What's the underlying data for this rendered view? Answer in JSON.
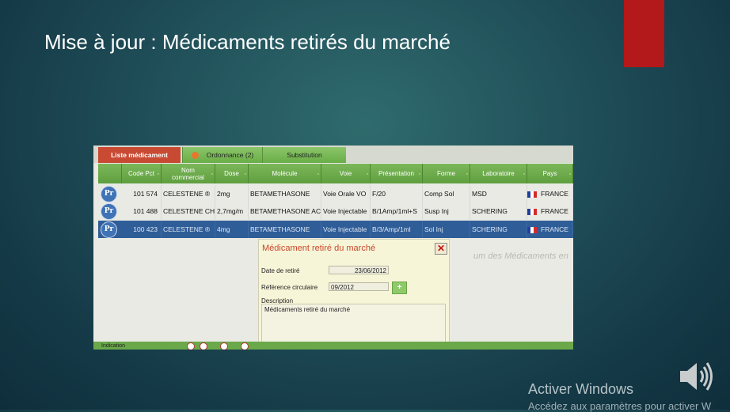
{
  "slide": {
    "title": "Mise à jour : Médicaments retirés du marché",
    "accent_color": "#b3191a"
  },
  "app": {
    "tabs": [
      {
        "label": "Liste médicament",
        "active": true
      },
      {
        "label": "Ordonnance (2)",
        "active": false,
        "icon": "pill-icon"
      },
      {
        "label": "Substitution",
        "active": false
      }
    ],
    "columns": [
      "Code Pct",
      "Nom commercial",
      "Dose",
      "Molécule",
      "Voie",
      "Présentation",
      "Forme",
      "Laboratoire",
      "Pays"
    ],
    "rows": [
      {
        "badge": "Pr",
        "code": "101 574",
        "nom": "CELESTENE ®",
        "dose": "2mg",
        "molecule": "BETAMETHASONE",
        "voie": "Voie Orale VO",
        "presentation": "F/20",
        "forme": "Comp Sol",
        "labo": "MSD",
        "pays": "FRANCE",
        "selected": false
      },
      {
        "badge": "Pr",
        "code": "101 488",
        "nom": "CELESTENE CHI",
        "dose": "2,7mg/m",
        "molecule": "BETAMETHASONE AC",
        "voie": "Voie Injectable",
        "presentation": "B/1Amp/1ml+S",
        "forme": "Susp Inj",
        "labo": "SCHERING",
        "pays": "FRANCE",
        "selected": false
      },
      {
        "badge": "Pr",
        "code": "100 423",
        "nom": "CELESTENE ®",
        "dose": "4mg",
        "molecule": "BETAMETHASONE",
        "voie": "Voie Injectable",
        "presentation": "B/3/Amp/1ml",
        "forme": "Sol Inj",
        "labo": "SCHERING",
        "pays": "FRANCE",
        "selected": true
      }
    ],
    "background_text": "um des Médicaments en",
    "bottom_label": "Indication",
    "dialog": {
      "title": "Médicament retiré du marché",
      "date_label": "Date de retiré",
      "date_value": "23/06/2012",
      "ref_label": "Référence circulaire",
      "ref_value": "09/2012",
      "add_label": "+",
      "desc_label": "Description",
      "desc_value": "Médicaments retiré du marché"
    }
  },
  "os": {
    "activate_title": "Activer Windows",
    "activate_sub": "Accédez aux paramètres pour activer W"
  }
}
